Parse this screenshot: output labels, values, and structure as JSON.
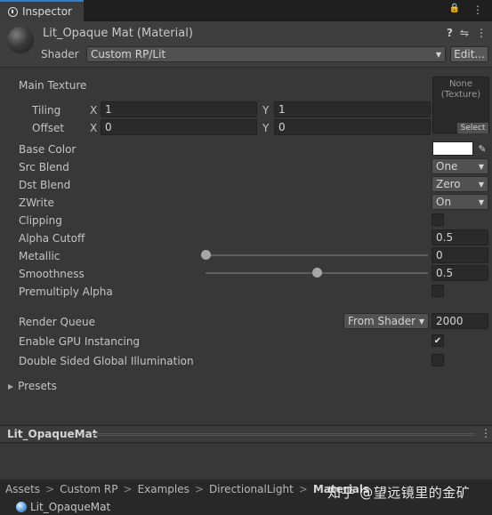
{
  "tab": {
    "title": "Inspector"
  },
  "tabbar": {
    "lock": "🔒",
    "menu": "⋮"
  },
  "header": {
    "material_name": "Lit_Opaque Mat (Material)",
    "help": "?",
    "settings": "⇋",
    "menu": "⋮",
    "shader_label": "Shader",
    "shader_value": "Custom RP/Lit",
    "edit_label": "Edit..."
  },
  "properties": {
    "main_texture": "Main Texture",
    "texture_none": "None",
    "texture_type": "(Texture)",
    "texture_select": "Select",
    "tiling": {
      "label": "Tiling",
      "x_axis": "X",
      "x": "1",
      "y_axis": "Y",
      "y": "1"
    },
    "offset": {
      "label": "Offset",
      "x_axis": "X",
      "x": "0",
      "y_axis": "Y",
      "y": "0"
    },
    "base_color": {
      "label": "Base Color",
      "color": "#ffffff"
    },
    "src_blend": {
      "label": "Src Blend",
      "value": "One"
    },
    "dst_blend": {
      "label": "Dst Blend",
      "value": "Zero"
    },
    "zwrite": {
      "label": "ZWrite",
      "value": "On"
    },
    "clipping": {
      "label": "Clipping",
      "checked": false
    },
    "alpha_cutoff": {
      "label": "Alpha Cutoff",
      "value": "0.5"
    },
    "metallic": {
      "label": "Metallic",
      "value": "0",
      "fraction": 0
    },
    "smoothness": {
      "label": "Smoothness",
      "value": "0.5",
      "fraction": 0.5
    },
    "premultiply_alpha": {
      "label": "Premultiply Alpha",
      "checked": false
    },
    "render_queue": {
      "label": "Render Queue",
      "mode": "From Shader",
      "value": "2000"
    },
    "gpu_instancing": {
      "label": "Enable GPU Instancing",
      "checked": true,
      "check": "✔"
    },
    "double_sided_gi": {
      "label": "Double Sided Global Illumination",
      "checked": false
    },
    "presets": {
      "label": "Presets"
    }
  },
  "footer": {
    "title": "Lit_OpaqueMat",
    "menu": "⋮"
  },
  "breadcrumb": [
    "Assets",
    "Custom RP",
    "Examples",
    "DirectionalLight",
    "Materials"
  ],
  "breadcrumb_separator": ">",
  "file": {
    "name": "Lit_OpaqueMat"
  },
  "watermark": "知乎 @望远镜里的金矿"
}
